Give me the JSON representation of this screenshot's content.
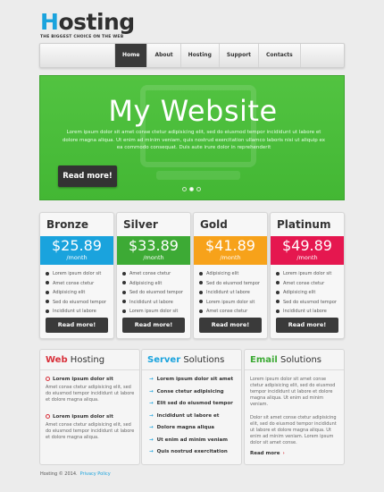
{
  "logo": {
    "first_letter": "H",
    "rest": "osting",
    "tagline": "THE BIGGEST CHOICE ON THE WEB"
  },
  "nav": {
    "items": [
      "Home",
      "About",
      "Hosting",
      "Support",
      "Contacts"
    ],
    "active": "Home"
  },
  "hero": {
    "title": "My Website",
    "text": "Lorem ipsum dolor sit amet conse ctetur adipisicing elit, sed do eiusmod tempor incididunt ut labore et dolore magna aliqua. Ut enim ad minim veniam, quis nostrud exercitation ullamco laboris nisi ut aliquip ex ea commodo consequat. Duis aute irure dolor in reprehenderit",
    "button": "Read more!",
    "slides": 3,
    "active_slide": 2,
    "color": "#4cbd3c"
  },
  "plans": [
    {
      "name": "Bronze",
      "price": "$25.89",
      "period": "/month",
      "color": "#1aa3dd",
      "features": [
        "Lorem ipsum dolor sit",
        "Amet conse ctetur",
        "Adipisicing elit",
        "Sed do eiusmod tempor",
        "Incididunt ut labore"
      ],
      "button": "Read more!"
    },
    {
      "name": "Silver",
      "price": "$33.89",
      "period": "/month",
      "color": "#3daa35",
      "features": [
        "Amet conse ctetur",
        "Adipisicing elit",
        "Sed do eiusmod tempor",
        "Incididunt ut labore",
        "Lorem ipsum dolor sit"
      ],
      "button": "Read more!"
    },
    {
      "name": "Gold",
      "price": "$41.89",
      "period": "/month",
      "color": "#f7a21a",
      "features": [
        "Adipisicing elit",
        "Sed do eiusmod tempor",
        "Incididunt ut labore",
        "Lorem ipsum dolor sit",
        "Amet conse ctetur"
      ],
      "button": "Read more!"
    },
    {
      "name": "Platinum",
      "price": "$49.89",
      "period": "/month",
      "color": "#e5174f",
      "features": [
        "Lorem ipsum dolor sit",
        "Amet conse ctetur",
        "Adipisicing elit",
        "Sed do eiusmod tempor",
        "Incididunt ut labore"
      ],
      "button": "Read more!"
    }
  ],
  "web_hosting": {
    "title_accent": "Web",
    "title_rest": " Hosting",
    "accent_color": "#d8303a",
    "items": [
      {
        "head": "Lorem ipsum dolor sit",
        "text": "Amet conse ctetur adipisicing elit, sed do eiusmod tempor incididunt ut labore et dolore magna aliqua."
      },
      {
        "head": "Lorem ipsum dolor sit",
        "text": "Amet conse ctetur adipisicing elit, sed do eiusmod tempor incididunt ut labore et dolore magna aliqua."
      }
    ]
  },
  "server_solutions": {
    "title_accent": "Server",
    "title_rest": " Solutions",
    "accent_color": "#1aa3dd",
    "items": [
      "Lorem ipsum dolor sit amet",
      "Conse ctetur adipisicing",
      "Elit sed do eiusmod tempor",
      "Incididunt ut labore et",
      "Dolore magna aliqua",
      "Ut enim ad minim veniam",
      "Quis nostrud exercitation"
    ]
  },
  "email_solutions": {
    "title_accent": "Email",
    "title_rest": " Solutions",
    "accent_color": "#3daa35",
    "paragraphs": [
      "Lorem ipsum dolor sit amet conse ctetur adipisicing elit, sed do eiusmod tempor incididunt ut labore et dolore magna aliqua. Ut enim ad minim veniam.",
      "Dolor sit amet conse ctetur adipisicing elit, sed do eiusmod tempor incididunt ut labore et dolore magna aliqua. Ut enim ad minim veniam. Lorem ipsum dolor sit amet conse."
    ],
    "link": "Read more"
  },
  "footer": {
    "copyright": "Hosting © 2014.",
    "link": "Privacy Policy"
  }
}
